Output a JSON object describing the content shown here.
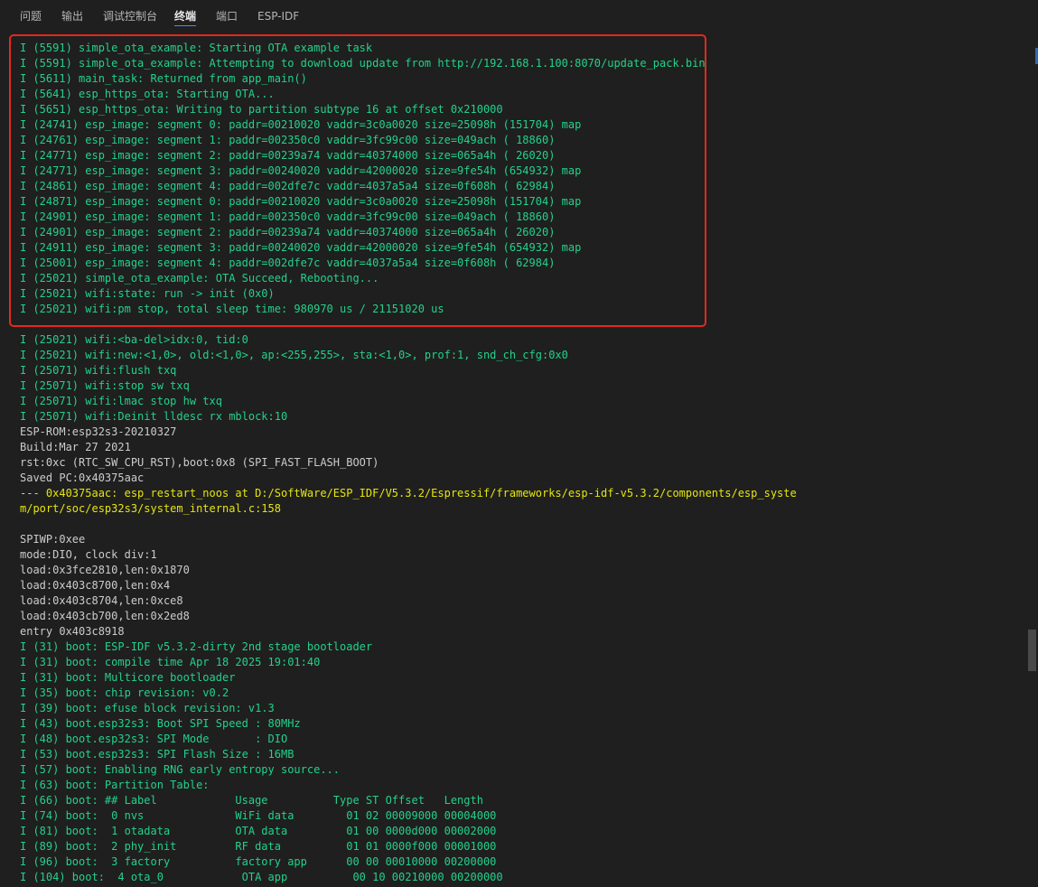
{
  "tabs": [
    {
      "label": "问题"
    },
    {
      "label": "输出"
    },
    {
      "label": "调试控制台"
    },
    {
      "label": "终端"
    },
    {
      "label": "端口"
    },
    {
      "label": "ESP-IDF"
    }
  ],
  "terminal": {
    "lines": [
      {
        "text": "I (5591) simple_ota_example: Starting OTA example task",
        "kind": "info"
      },
      {
        "text": "I (5591) simple_ota_example: Attempting to download update from http://192.168.1.100:8070/update_pack.bin",
        "kind": "info"
      },
      {
        "text": "I (5611) main_task: Returned from app_main()",
        "kind": "info"
      },
      {
        "text": "I (5641) esp_https_ota: Starting OTA...",
        "kind": "info"
      },
      {
        "text": "I (5651) esp_https_ota: Writing to partition subtype 16 at offset 0x210000",
        "kind": "info"
      },
      {
        "text": "I (24741) esp_image: segment 0: paddr=00210020 vaddr=3c0a0020 size=25098h (151704) map",
        "kind": "info"
      },
      {
        "text": "I (24761) esp_image: segment 1: paddr=002350c0 vaddr=3fc99c00 size=049ach ( 18860)",
        "kind": "info"
      },
      {
        "text": "I (24771) esp_image: segment 2: paddr=00239a74 vaddr=40374000 size=065a4h ( 26020)",
        "kind": "info"
      },
      {
        "text": "I (24771) esp_image: segment 3: paddr=00240020 vaddr=42000020 size=9fe54h (654932) map",
        "kind": "info"
      },
      {
        "text": "I (24861) esp_image: segment 4: paddr=002dfe7c vaddr=4037a5a4 size=0f608h ( 62984)",
        "kind": "info"
      },
      {
        "text": "I (24871) esp_image: segment 0: paddr=00210020 vaddr=3c0a0020 size=25098h (151704) map",
        "kind": "info"
      },
      {
        "text": "I (24901) esp_image: segment 1: paddr=002350c0 vaddr=3fc99c00 size=049ach ( 18860)",
        "kind": "info"
      },
      {
        "text": "I (24901) esp_image: segment 2: paddr=00239a74 vaddr=40374000 size=065a4h ( 26020)",
        "kind": "info"
      },
      {
        "text": "I (24911) esp_image: segment 3: paddr=00240020 vaddr=42000020 size=9fe54h (654932) map",
        "kind": "info"
      },
      {
        "text": "I (25001) esp_image: segment 4: paddr=002dfe7c vaddr=4037a5a4 size=0f608h ( 62984)",
        "kind": "info"
      },
      {
        "text": "I (25021) simple_ota_example: OTA Succeed, Rebooting...",
        "kind": "info"
      },
      {
        "text": "I (25021) wifi:state: run -> init (0x0)",
        "kind": "info"
      },
      {
        "text": "I (25021) wifi:pm stop, total sleep time: 980970 us / 21151020 us",
        "kind": "info"
      },
      {
        "text": "",
        "kind": "plain"
      },
      {
        "text": "I (25021) wifi:<ba-del>idx:0, tid:0",
        "kind": "info"
      },
      {
        "text": "I (25021) wifi:new:<1,0>, old:<1,0>, ap:<255,255>, sta:<1,0>, prof:1, snd_ch_cfg:0x0",
        "kind": "info"
      },
      {
        "text": "I (25071) wifi:flush txq",
        "kind": "info"
      },
      {
        "text": "I (25071) wifi:stop sw txq",
        "kind": "info"
      },
      {
        "text": "I (25071) wifi:lmac stop hw txq",
        "kind": "info"
      },
      {
        "text": "I (25071) wifi:Deinit lldesc rx mblock:10",
        "kind": "info"
      },
      {
        "text": "ESP-ROM:esp32s3-20210327",
        "kind": "plain"
      },
      {
        "text": "Build:Mar 27 2021",
        "kind": "plain"
      },
      {
        "text": "rst:0xc (RTC_SW_CPU_RST),boot:0x8 (SPI_FAST_FLASH_BOOT)",
        "kind": "plain"
      },
      {
        "text": "Saved PC:0x40375aac",
        "kind": "plain"
      },
      {
        "text": "--- 0x40375aac: esp_restart_noos at D:/SoftWare/ESP_IDF/V5.3.2/Espressif/frameworks/esp-idf-v5.3.2/components/esp_syste",
        "kind": "warn"
      },
      {
        "text": "m/port/soc/esp32s3/system_internal.c:158",
        "kind": "warn"
      },
      {
        "text": "",
        "kind": "plain"
      },
      {
        "text": "SPIWP:0xee",
        "kind": "plain"
      },
      {
        "text": "mode:DIO, clock div:1",
        "kind": "plain"
      },
      {
        "text": "load:0x3fce2810,len:0x1870",
        "kind": "plain"
      },
      {
        "text": "load:0x403c8700,len:0x4",
        "kind": "plain"
      },
      {
        "text": "load:0x403c8704,len:0xce8",
        "kind": "plain"
      },
      {
        "text": "load:0x403cb700,len:0x2ed8",
        "kind": "plain"
      },
      {
        "text": "entry 0x403c8918",
        "kind": "plain"
      },
      {
        "text": "I (31) boot: ESP-IDF v5.3.2-dirty 2nd stage bootloader",
        "kind": "info"
      },
      {
        "text": "I (31) boot: compile time Apr 18 2025 19:01:40",
        "kind": "info"
      },
      {
        "text": "I (31) boot: Multicore bootloader",
        "kind": "info"
      },
      {
        "text": "I (35) boot: chip revision: v0.2",
        "kind": "info"
      },
      {
        "text": "I (39) boot: efuse block revision: v1.3",
        "kind": "info"
      },
      {
        "text": "I (43) boot.esp32s3: Boot SPI Speed : 80MHz",
        "kind": "info"
      },
      {
        "text": "I (48) boot.esp32s3: SPI Mode       : DIO",
        "kind": "info"
      },
      {
        "text": "I (53) boot.esp32s3: SPI Flash Size : 16MB",
        "kind": "info"
      },
      {
        "text": "I (57) boot: Enabling RNG early entropy source...",
        "kind": "info"
      },
      {
        "text": "I (63) boot: Partition Table:",
        "kind": "info"
      },
      {
        "text": "I (66) boot: ## Label            Usage          Type ST Offset   Length",
        "kind": "info"
      },
      {
        "text": "I (74) boot:  0 nvs              WiFi data        01 02 00009000 00004000",
        "kind": "info"
      },
      {
        "text": "I (81) boot:  1 otadata          OTA data         01 00 0000d000 00002000",
        "kind": "info"
      },
      {
        "text": "I (89) boot:  2 phy_init         RF data          01 01 0000f000 00001000",
        "kind": "info"
      },
      {
        "text": "I (96) boot:  3 factory          factory app      00 00 00010000 00200000",
        "kind": "info"
      },
      {
        "text": "I (104) boot:  4 ota_0            OTA app          00 10 00210000 00200000",
        "kind": "info"
      }
    ]
  },
  "colors": {
    "background": "#1f1f1f",
    "info_green": "#23d18b",
    "warn_yellow": "#e5e510",
    "plain_text": "#cccccc",
    "highlight_box": "#e02b1f",
    "active_tab_underline": "#3794ff"
  }
}
